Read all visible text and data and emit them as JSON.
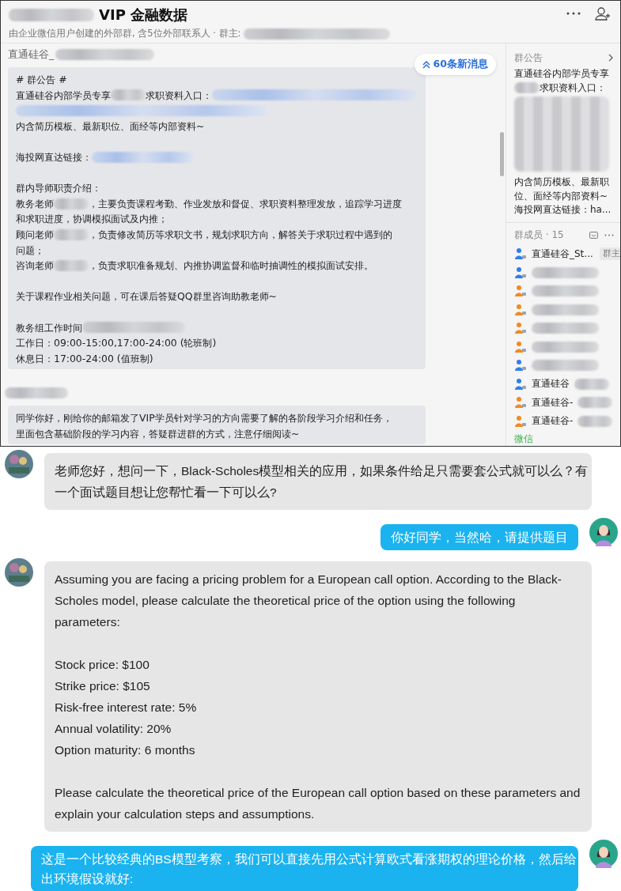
{
  "header": {
    "title": "VIP 金融数据",
    "subtitle": "由企业微信用户创建的外部群, 含5位外部联系人 · 群主:"
  },
  "chat": {
    "new_messages": "60条新消息",
    "messages": [
      {
        "sender": "直通硅谷_",
        "paragraphs": [
          [
            [
              {
                "kind": "text",
                "text": "# 群公告 #"
              }
            ],
            [
              {
                "kind": "text",
                "text": "直通硅谷内部学员专享"
              },
              {
                "kind": "blur"
              },
              {
                "kind": "text",
                "text": "求职资料入口："
              },
              {
                "kind": "link"
              }
            ],
            [
              {
                "kind": "link"
              }
            ],
            [
              {
                "kind": "text",
                "text": "内含简历模板、最新职位、面经等内部资料~"
              }
            ]
          ],
          [
            [
              {
                "kind": "text",
                "text": "海投网直达链接："
              },
              {
                "kind": "link"
              }
            ]
          ],
          [
            [
              {
                "kind": "text",
                "text": "群内导师职责介绍："
              }
            ],
            [
              {
                "kind": "text",
                "text": "教务老师"
              },
              {
                "kind": "blur"
              },
              {
                "kind": "text",
                "text": "，主要负责课程考勤、作业发放和督促、求职资料整理发放，追踪学习进度"
              }
            ],
            [
              {
                "kind": "text",
                "text": "和求职进度，协调模拟面试及内推；"
              }
            ],
            [
              {
                "kind": "text",
                "text": "顾问老师"
              },
              {
                "kind": "blur"
              },
              {
                "kind": "text",
                "text": "，负责修改简历等求职文书，规划求职方向，解答关于求职过程中遇到的"
              }
            ],
            [
              {
                "kind": "text",
                "text": "问题；"
              }
            ],
            [
              {
                "kind": "text",
                "text": "咨询老师"
              },
              {
                "kind": "blur"
              },
              {
                "kind": "text",
                "text": "，负责求职准备规划、内推协调监督和临时抽调性的模拟面试安排。"
              }
            ]
          ],
          [
            [
              {
                "kind": "text",
                "text": "关于课程作业相关问题，可在课后答疑QQ群里咨询助教老师~"
              }
            ]
          ],
          [
            [
              {
                "kind": "text",
                "text": "教务组工作时间"
              },
              {
                "kind": "blur"
              }
            ],
            [
              {
                "kind": "text",
                "text": "工作日：09:00-15:00,17:00-24:00 (轮班制)"
              }
            ],
            [
              {
                "kind": "text",
                "text": "休息日：17:00-24:00 (值班制)"
              }
            ]
          ]
        ]
      },
      {
        "paragraphs": [
          [
            [
              {
                "kind": "text",
                "text": "同学你好，刚给你的邮箱发了VIP学员针对学习的方向需要了解的各阶段学习介绍和任务，"
              }
            ],
            [
              {
                "kind": "text",
                "text": "里面包含基础阶段的学习内容，答疑群进群的方式，注意仔细阅读~"
              }
            ]
          ]
        ]
      }
    ]
  },
  "side_panel": {
    "announcement": {
      "title": "群公告",
      "lines": [
        "直通硅谷内部学员专享",
        "求职资料入口：",
        "内含简历模板、最新职位、面经等内部资料~",
        "海投网直达链接：ha..."
      ]
    },
    "members": {
      "title": "群成员 · 15",
      "items": [
        {
          "name": "直通硅谷_St...",
          "badge": "群主",
          "color": "#2f7ef0"
        },
        {
          "color": "#2f7ef0"
        },
        {
          "color": "#f5891f"
        },
        {
          "color": "#f5891f"
        },
        {
          "color": "#f5891f"
        },
        {
          "color": "#f5891f"
        },
        {
          "color": "#2f7ef0"
        },
        {
          "name": "直通硅谷",
          "color": "#2f7ef0"
        },
        {
          "name": "直通硅谷-",
          "color": "#f5891f"
        },
        {
          "name": "直通硅谷-",
          "color": "#f5891f"
        }
      ]
    },
    "footer": "微信"
  },
  "conversation": [
    {
      "kind": "incoming",
      "paragraphs": [
        [
          "老师您好，想问一下，Black-Scholes模型相关的应用，如果条件给足只需要套公式就可以么？有",
          "一个面试题目想让您帮忙看一下可以么?"
        ]
      ]
    },
    {
      "kind": "outgoing",
      "paragraphs": [
        [
          "你好同学，当然哈，请提供题目"
        ]
      ]
    },
    {
      "kind": "incoming",
      "paragraphs": [
        [
          "Assuming you are facing a pricing problem for a European call option. According to the Black-Scholes model, please calculate the theoretical price of the option using the following parameters:"
        ],
        [
          "Stock price: $100",
          "Strike price: $105",
          "Risk-free interest rate: 5%",
          "Annual volatility: 20%",
          "Option maturity: 6 months"
        ],
        [
          "Please calculate the theoretical price of the European call option based on these parameters and explain your calculation steps and assumptions."
        ]
      ]
    },
    {
      "kind": "outgoing",
      "paragraphs": [
        [
          "这是一个比较经典的BS模型考察，我们可以直接先用公式计算欧式看涨期权的理论价格，然后给",
          "出环境假设就好:"
        ]
      ]
    }
  ]
}
